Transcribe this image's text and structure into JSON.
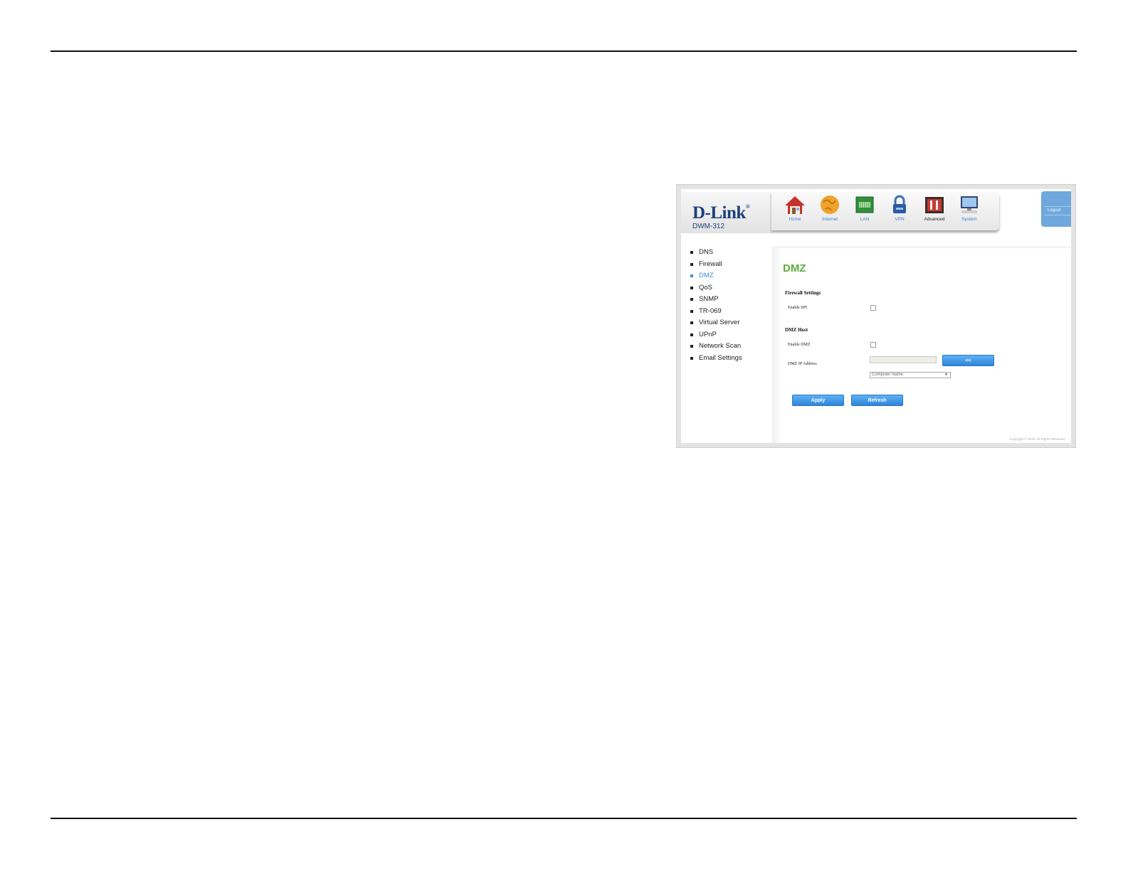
{
  "device": {
    "brand": "D-Link",
    "registered_mark": "®",
    "model": "DWM-312"
  },
  "nav": {
    "items": [
      {
        "label": "Home",
        "icon": "home-icon"
      },
      {
        "label": "Internet",
        "icon": "globe-icon"
      },
      {
        "label": "LAN",
        "icon": "lan-icon"
      },
      {
        "label": "VPN",
        "icon": "lock-icon"
      },
      {
        "label": "Advanced",
        "icon": "toolbox-icon"
      },
      {
        "label": "System",
        "icon": "monitor-icon"
      }
    ],
    "active": "Advanced",
    "logout_label": "Logout"
  },
  "sidebar": {
    "items": [
      {
        "label": "DNS"
      },
      {
        "label": "Firewall"
      },
      {
        "label": "DMZ"
      },
      {
        "label": "QoS"
      },
      {
        "label": "SNMP"
      },
      {
        "label": "TR-069"
      },
      {
        "label": "Virtual Server"
      },
      {
        "label": "UPnP"
      },
      {
        "label": "Network Scan"
      },
      {
        "label": "Email Settings"
      }
    ],
    "active": "DMZ"
  },
  "main": {
    "title": "DMZ",
    "firewall_settings": {
      "heading": "Firewall Settings",
      "enable_spi_label": "Enable SPI",
      "enable_spi_checked": false
    },
    "dmz_host": {
      "heading": "DMZ Host",
      "enable_dmz_label": "Enable DMZ",
      "enable_dmz_checked": false,
      "ip_label": "DMZ IP Address",
      "ip_value": "",
      "copy_button_label": "<<",
      "computer_select_value": "Computer Name"
    },
    "apply_label": "Apply",
    "refresh_label": "Refresh",
    "copyright": "Copyright © 2012. All Rights Reserved."
  },
  "colors": {
    "accent_blue": "#3b8ee0",
    "title_green": "#58b03a",
    "brand_navy": "#1a3f7c"
  }
}
